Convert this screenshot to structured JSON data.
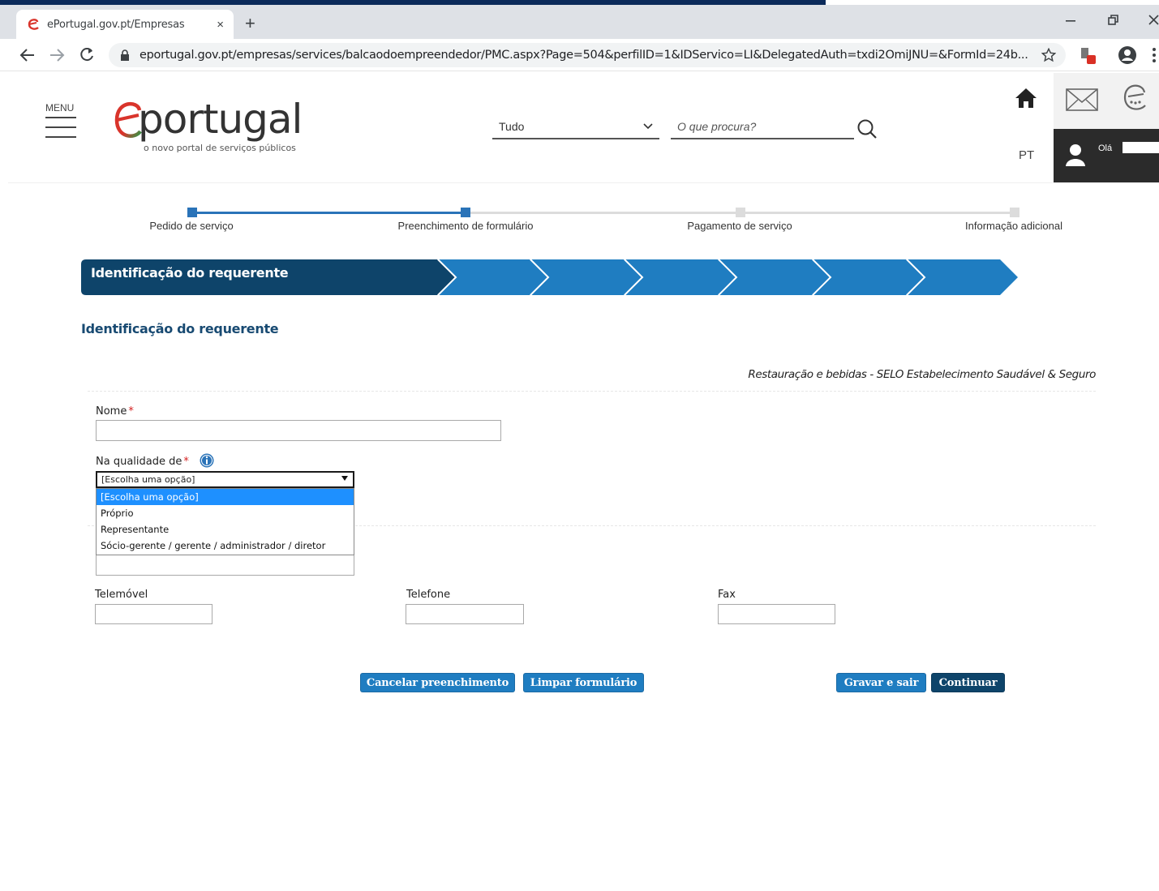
{
  "browser": {
    "tab_title": "ePortugal.gov.pt/Empresas",
    "tab_close": "×",
    "new_tab": "+",
    "url": "eportugal.gov.pt/empresas/services/balcaodoempreendedor/PMC.aspx?Page=504&perfilID=1&IDServico=LI&DelegatedAuth=txdi2OmiJNU=&FormId=24b..."
  },
  "header": {
    "menu_label": "MENU",
    "logo_word": "portugal",
    "logo_tagline": "o novo portal de serviços públicos",
    "search_category": "Tudo",
    "search_placeholder": "O que procura?",
    "language": "PT",
    "user_greeting": "Olá"
  },
  "steps": [
    {
      "label": "Pedido de serviço",
      "status": "done"
    },
    {
      "label": "Preenchimento de formulário",
      "status": "current"
    },
    {
      "label": "Pagamento de serviço",
      "status": "pending"
    },
    {
      "label": "Informação adicional",
      "status": "pending"
    }
  ],
  "form": {
    "banner_title": "Identificação do requerente",
    "section_title": "Identificação do requerente",
    "service_name": "Restauração e bebidas - SELO Estabelecimento Saudável & Seguro",
    "required_mark": "*",
    "nome_label": "Nome",
    "qualidade_label": "Na qualidade de",
    "qualidade_selected": "[Escolha uma opção]",
    "qualidade_options": [
      "[Escolha uma opção]",
      "Próprio",
      "Representante",
      "Sócio-gerente / gerente / administrador / diretor"
    ],
    "telemovel_label": "Telemóvel",
    "telefone_label": "Telefone",
    "fax_label": "Fax"
  },
  "buttons": {
    "cancel": "Cancelar preenchimento",
    "clear": "Limpar formulário",
    "save_exit": "Gravar e sair",
    "continue": "Continuar"
  },
  "colors": {
    "banner_dark": "#0e446a",
    "banner_light": "#1f7dc1",
    "step_done": "#2a73b8",
    "required": "#d42020",
    "selection": "#1e90ff"
  }
}
